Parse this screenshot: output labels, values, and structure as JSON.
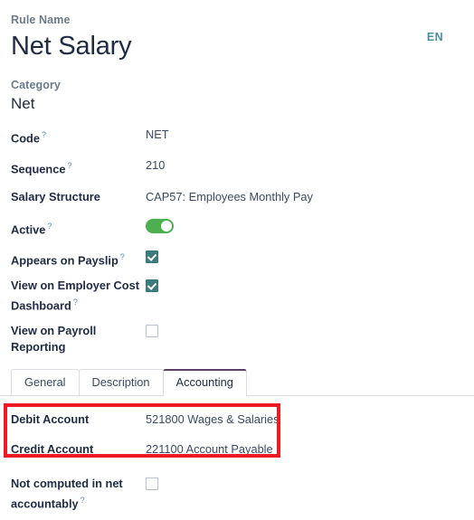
{
  "header": {
    "rule_name_caption": "Rule Name",
    "rule_name_value": "Net Salary",
    "category_caption": "Category",
    "category_value": "Net",
    "language_badge": "EN"
  },
  "fields": [
    {
      "label": "Code",
      "has_help": true,
      "value": "NET",
      "type": "text"
    },
    {
      "label": "Sequence",
      "has_help": true,
      "value": "210",
      "type": "text"
    },
    {
      "label": "Salary Structure",
      "has_help": false,
      "value": "CAP57: Employees Monthly Pay",
      "type": "text"
    },
    {
      "label": "Active",
      "has_help": true,
      "value": "on",
      "type": "toggle"
    },
    {
      "label": "Appears on Payslip",
      "has_help": true,
      "value": "checked",
      "type": "checkbox"
    },
    {
      "label": "View on Employer Cost Dashboard",
      "has_help": true,
      "value": "checked",
      "type": "checkbox"
    },
    {
      "label": "View on Payroll Reporting",
      "has_help": false,
      "value": "unchecked",
      "type": "checkbox"
    }
  ],
  "tabs": [
    {
      "label": "General",
      "active": false
    },
    {
      "label": "Description",
      "active": false
    },
    {
      "label": "Accounting",
      "active": true
    }
  ],
  "accounting": {
    "rows": [
      {
        "label": "Debit Account",
        "has_help": false,
        "value": "521800 Wages & Salaries"
      },
      {
        "label": "Credit Account",
        "has_help": false,
        "value": "221100 Account Payable"
      }
    ],
    "highlight_color": "#ed1b24"
  },
  "footer": {
    "label": "Not computed in net accountably",
    "has_help": true,
    "value": "unchecked"
  },
  "colors": {
    "toggle_on": "#4caf50",
    "checkbox_checked": "#3a7b7e",
    "active_tab_accent": "#5b3e63",
    "help_icon": "#4a90c4",
    "language_badge": "#4a90a4",
    "highlight": "#ed1b24"
  },
  "icons": {
    "help": "?"
  }
}
